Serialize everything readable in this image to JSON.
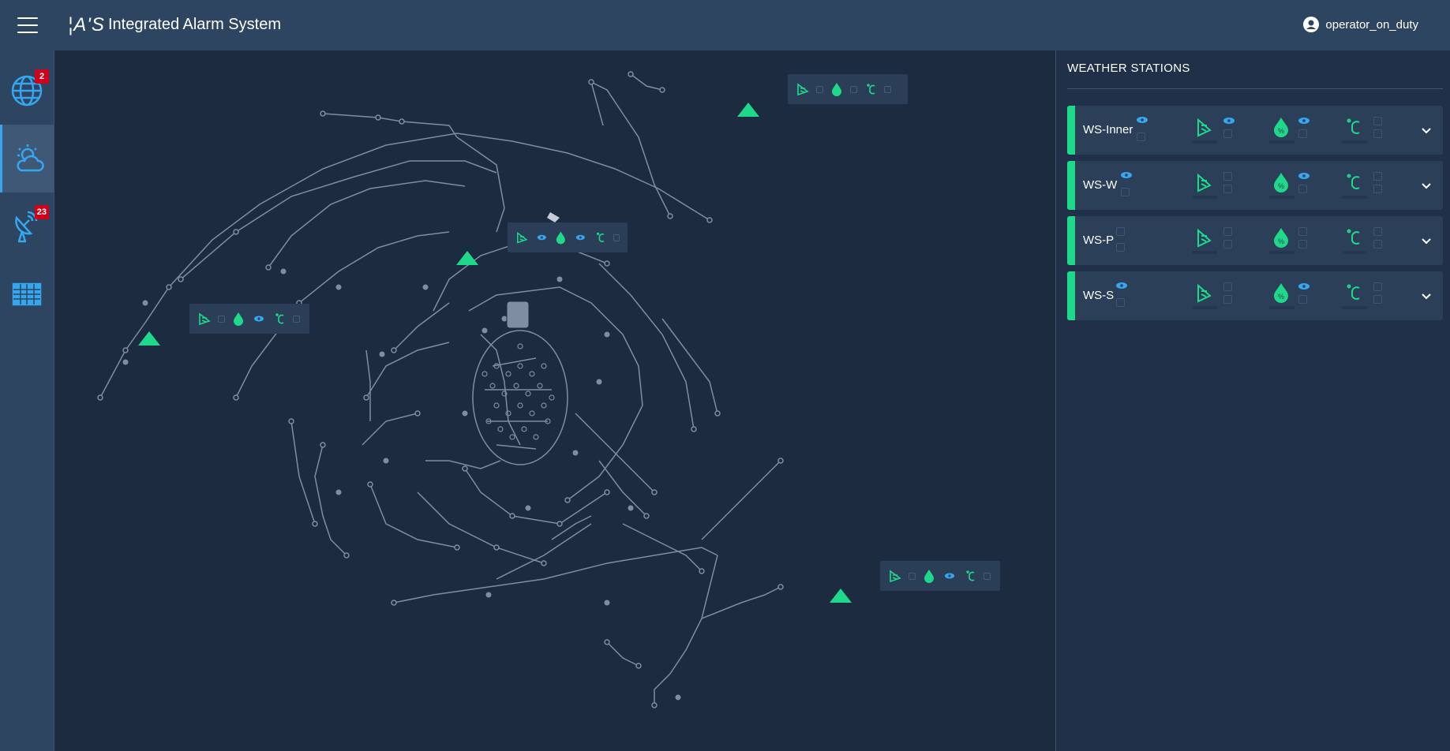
{
  "header": {
    "logo_text": "¦A'S",
    "title": "Integrated Alarm System",
    "user": "operator_on_duty"
  },
  "sidebar": {
    "items": [
      {
        "name": "overview",
        "icon": "globe-icon",
        "badge": "2",
        "active": false
      },
      {
        "name": "weather",
        "icon": "weather-cloud-icon",
        "badge": "",
        "active": true
      },
      {
        "name": "antennas",
        "icon": "antenna-icon",
        "badge": "23",
        "active": false
      },
      {
        "name": "table",
        "icon": "table-icon",
        "badge": "",
        "active": false
      }
    ]
  },
  "weather": {
    "title": "WEATHER STATIONS",
    "stations": [
      {
        "name": "WS-Inner",
        "status_color": "#1fd98a"
      },
      {
        "name": "WS-W",
        "status_color": "#1fd98a"
      },
      {
        "name": "WS-P",
        "status_color": "#1fd98a"
      },
      {
        "name": "WS-S",
        "status_color": "#1fd98a"
      }
    ]
  },
  "colors": {
    "accent": "#35a6ef",
    "ok": "#1fd98a",
    "alarm": "#d0021b",
    "road": "#7f8da3"
  }
}
